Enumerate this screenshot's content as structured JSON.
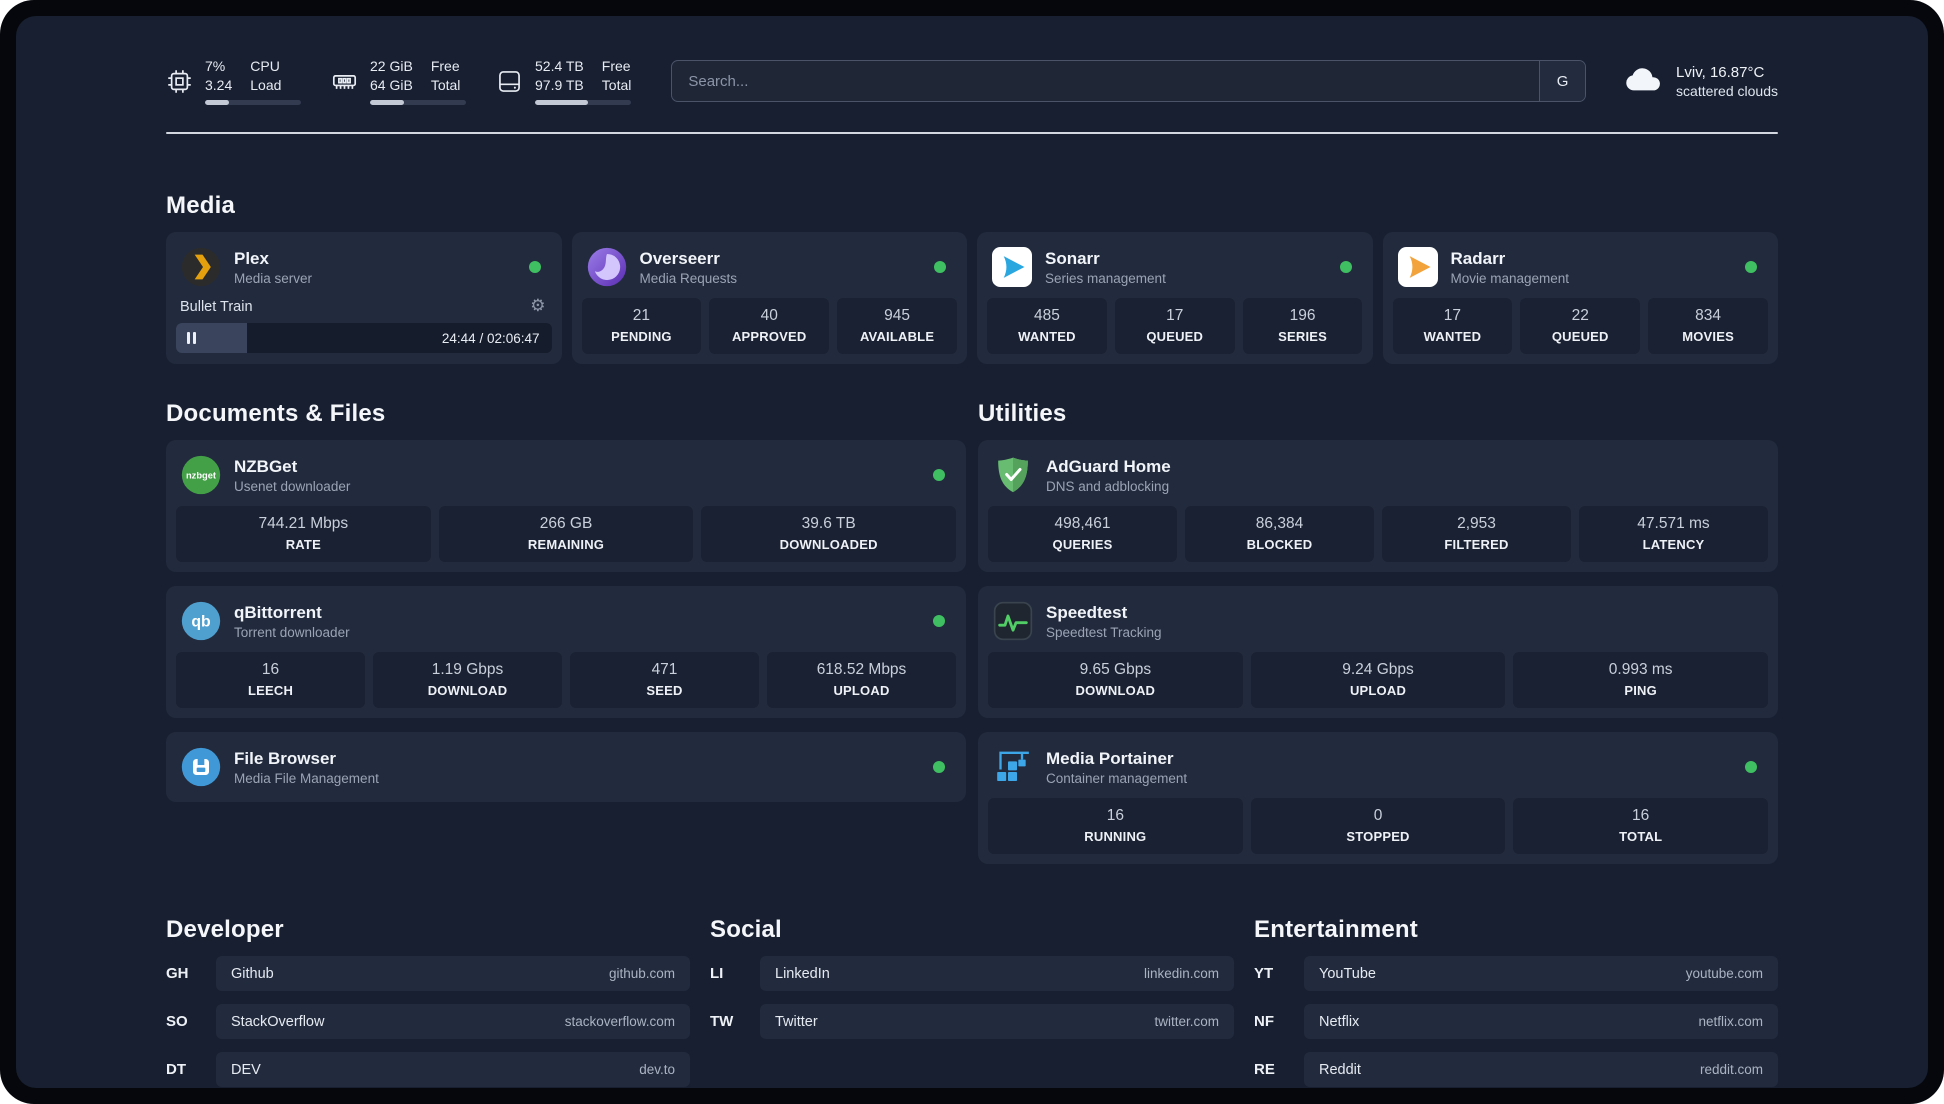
{
  "topbar": {
    "system": [
      {
        "value1": "7%",
        "value2": "3.24",
        "label1": "CPU",
        "label2": "Load",
        "progress_pct": 25
      },
      {
        "value1": "22 GiB",
        "value2": "64 GiB",
        "label1": "Free",
        "label2": "Total",
        "progress_pct": 35
      },
      {
        "value1": "52.4 TB",
        "value2": "97.9 TB",
        "label1": "Free",
        "label2": "Total",
        "progress_pct": 55
      }
    ],
    "search": {
      "placeholder": "Search...",
      "button_label": "G"
    },
    "weather": {
      "location": "Lviv, 16.87°C",
      "condition": "scattered clouds"
    }
  },
  "sections": {
    "media": {
      "title": "Media"
    },
    "documents": {
      "title": "Documents & Files"
    },
    "utilities": {
      "title": "Utilities"
    },
    "developer": {
      "title": "Developer"
    },
    "social": {
      "title": "Social"
    },
    "entertainment": {
      "title": "Entertainment"
    }
  },
  "apps": {
    "plex": {
      "name": "Plex",
      "subtitle": "Media server",
      "now_playing": "Bullet Train",
      "elapsed_total": "24:44 / 02:06:47",
      "progress_pct": 19
    },
    "overseerr": {
      "name": "Overseerr",
      "subtitle": "Media Requests",
      "stats": [
        {
          "value": "21",
          "label": "PENDING"
        },
        {
          "value": "40",
          "label": "APPROVED"
        },
        {
          "value": "945",
          "label": "AVAILABLE"
        }
      ]
    },
    "sonarr": {
      "name": "Sonarr",
      "subtitle": "Series management",
      "stats": [
        {
          "value": "485",
          "label": "WANTED"
        },
        {
          "value": "17",
          "label": "QUEUED"
        },
        {
          "value": "196",
          "label": "SERIES"
        }
      ]
    },
    "radarr": {
      "name": "Radarr",
      "subtitle": "Movie management",
      "stats": [
        {
          "value": "17",
          "label": "WANTED"
        },
        {
          "value": "22",
          "label": "QUEUED"
        },
        {
          "value": "834",
          "label": "MOVIES"
        }
      ]
    },
    "nzbget": {
      "name": "NZBGet",
      "subtitle": "Usenet downloader",
      "stats": [
        {
          "value": "744.21 Mbps",
          "label": "RATE"
        },
        {
          "value": "266 GB",
          "label": "REMAINING"
        },
        {
          "value": "39.6 TB",
          "label": "DOWNLOADED"
        }
      ]
    },
    "qbittorrent": {
      "name": "qBittorrent",
      "subtitle": "Torrent downloader",
      "stats": [
        {
          "value": "16",
          "label": "LEECH"
        },
        {
          "value": "1.19 Gbps",
          "label": "DOWNLOAD"
        },
        {
          "value": "471",
          "label": "SEED"
        },
        {
          "value": "618.52 Mbps",
          "label": "UPLOAD"
        }
      ]
    },
    "filebrowser": {
      "name": "File Browser",
      "subtitle": "Media File Management"
    },
    "adguard": {
      "name": "AdGuard Home",
      "subtitle": "DNS and adblocking",
      "stats": [
        {
          "value": "498,461",
          "label": "QUERIES"
        },
        {
          "value": "86,384",
          "label": "BLOCKED"
        },
        {
          "value": "2,953",
          "label": "FILTERED"
        },
        {
          "value": "47.571 ms",
          "label": "LATENCY"
        }
      ]
    },
    "speedtest": {
      "name": "Speedtest",
      "subtitle": "Speedtest Tracking",
      "stats": [
        {
          "value": "9.65 Gbps",
          "label": "DOWNLOAD"
        },
        {
          "value": "9.24 Gbps",
          "label": "UPLOAD"
        },
        {
          "value": "0.993 ms",
          "label": "PING"
        }
      ]
    },
    "portainer": {
      "name": "Media Portainer",
      "subtitle": "Container management",
      "stats": [
        {
          "value": "16",
          "label": "RUNNING"
        },
        {
          "value": "0",
          "label": "STOPPED"
        },
        {
          "value": "16",
          "label": "TOTAL"
        }
      ]
    }
  },
  "bookmarks": {
    "developer": [
      {
        "abbr": "GH",
        "name": "Github",
        "url": "github.com"
      },
      {
        "abbr": "SO",
        "name": "StackOverflow",
        "url": "stackoverflow.com"
      },
      {
        "abbr": "DT",
        "name": "DEV",
        "url": "dev.to"
      }
    ],
    "social": [
      {
        "abbr": "LI",
        "name": "LinkedIn",
        "url": "linkedin.com"
      },
      {
        "abbr": "TW",
        "name": "Twitter",
        "url": "twitter.com"
      }
    ],
    "entertainment": [
      {
        "abbr": "YT",
        "name": "YouTube",
        "url": "youtube.com"
      },
      {
        "abbr": "NF",
        "name": "Netflix",
        "url": "netflix.com"
      },
      {
        "abbr": "RE",
        "name": "Reddit",
        "url": "reddit.com"
      }
    ]
  },
  "icons": {
    "gear": "⚙"
  },
  "colors": {
    "status_online": "#3fbf61",
    "background": "#171f30",
    "card": "#222b3d",
    "tile": "#1a2132",
    "plex_accent": "#e5a00d"
  }
}
